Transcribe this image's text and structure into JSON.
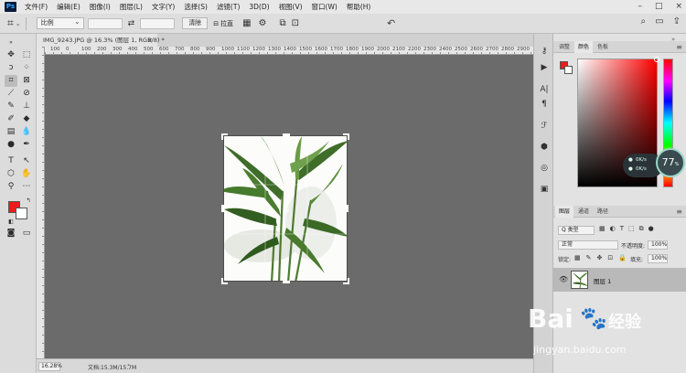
{
  "app": {
    "logo": "Ps"
  },
  "menu": [
    "文件(F)",
    "编辑(E)",
    "图像(I)",
    "图层(L)",
    "文字(Y)",
    "选择(S)",
    "滤镜(T)",
    "3D(D)",
    "视图(V)",
    "窗口(W)",
    "帮助(H)"
  ],
  "window_controls": {
    "minimize": "–",
    "maximize": "□",
    "close": "×"
  },
  "options_bar": {
    "ratio_select": "比例",
    "swap_icon": "⇄",
    "clear_button": "清除",
    "straighten_label": "拉直",
    "undo_icon": "↶"
  },
  "document": {
    "tab_title": "IMG_9243.JPG @ 16.3% (图层 1, RGB/8) *",
    "tab_close": "×",
    "zoom": "16.28%",
    "doc_info": "文档:15.3M/15.7M",
    "status_arrow": "›"
  },
  "rulers": {
    "top_numbers": [
      "100",
      "0",
      "100",
      "200",
      "300",
      "400",
      "500",
      "600",
      "700",
      "800",
      "900",
      "1000",
      "1100",
      "1200",
      "1300",
      "1400",
      "1500",
      "1600",
      "1700",
      "1800",
      "1900",
      "2000",
      "2100",
      "2200",
      "2300",
      "2400",
      "2500",
      "2600",
      "2700",
      "2800",
      "2900"
    ]
  },
  "color_panel": {
    "tabs": [
      "调整",
      "颜色",
      "色板"
    ],
    "active_tab": 1,
    "fg_color": "#ee1b1b",
    "bg_color": "#ffffff"
  },
  "net_widget": {
    "upload": "0K/s",
    "download": "0K/s",
    "gauge": "77",
    "gauge_unit": "%"
  },
  "layers_panel": {
    "tabs": [
      "图层",
      "通道",
      "路径"
    ],
    "active_tab": 0,
    "filter_select": "Q 类型",
    "blend_mode": "正常",
    "opacity_label": "不透明度:",
    "opacity_value": "100%",
    "lock_label": "锁定:",
    "fill_label": "填充:",
    "fill_value": "100%",
    "layer_name": "图层 1",
    "eye_icon": "👁"
  },
  "watermark": {
    "brand": "Bai",
    "brand_cn": "经验",
    "site": "jingyan.baidu.com"
  }
}
